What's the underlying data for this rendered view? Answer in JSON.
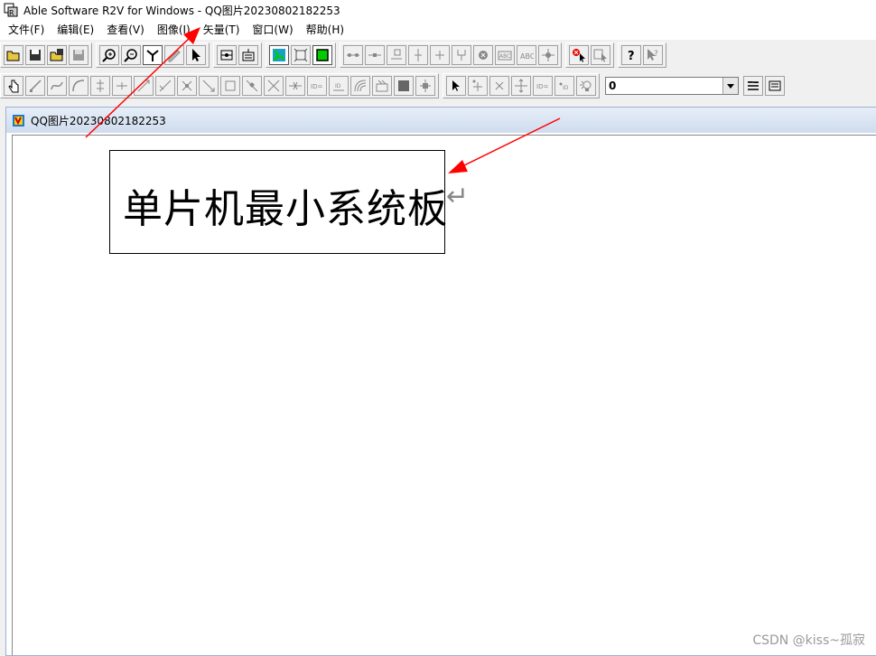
{
  "window": {
    "title": "Able Software R2V for Windows - QQ图片20230802182253"
  },
  "menu": [
    {
      "label": "文件(F)"
    },
    {
      "label": "编辑(E)"
    },
    {
      "label": "查看(V)"
    },
    {
      "label": "图像(I)"
    },
    {
      "label": "矢量(T)"
    },
    {
      "label": "窗口(W)"
    },
    {
      "label": "帮助(H)"
    }
  ],
  "toolbar2": {
    "combo_value": "0"
  },
  "document": {
    "title": "QQ图片20230802182253",
    "text": "单片机最小系统板",
    "return_mark": "↵"
  },
  "watermark": "CSDN @kiss~孤寂",
  "colors": {
    "annotation_arrow": "#ff0000",
    "doc_title_bg": "#cfdcee"
  }
}
